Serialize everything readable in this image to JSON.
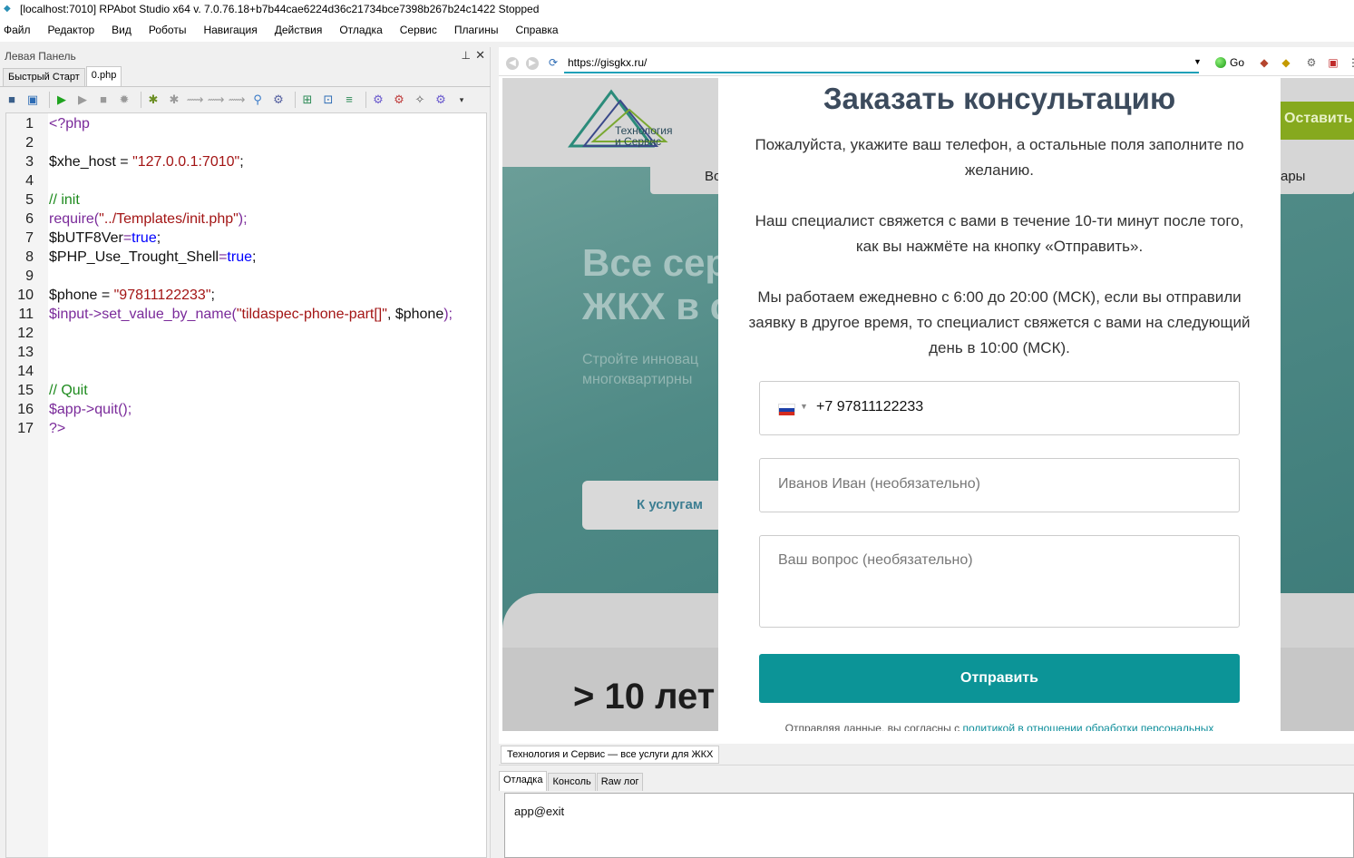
{
  "window": {
    "title": "[localhost:7010] RPAbot Studio x64 v. 7.0.76.18+b7b44cae6224d36c21734bce7398b267b24c1422 Stopped"
  },
  "menubar": {
    "items": [
      "Файл",
      "Редактор",
      "Вид",
      "Роботы",
      "Навигация",
      "Действия",
      "Отладка",
      "Сервис",
      "Плагины",
      "Справка"
    ]
  },
  "left_panel": {
    "title": "Левая Панель",
    "tabs": [
      "Быстрый Старт",
      "0.php"
    ],
    "active_tab": "0.php"
  },
  "editor": {
    "line_numbers": [
      "1",
      "2",
      "3",
      "4",
      "5",
      "6",
      "7",
      "8",
      "9",
      "10",
      "11",
      "12",
      "13",
      "14",
      "15",
      "16",
      "17"
    ]
  },
  "browser": {
    "url": "https://gisgkx.ru/",
    "go_label": "Go",
    "page_title_tab": "Технология и Сервис — все услуги для ЖКХ"
  },
  "site": {
    "logo_line1": "Технология",
    "logo_line2": "и Сервис",
    "cta": "Оставить",
    "menu_left": "Во",
    "menu_right": "ары",
    "hero_line1": "Все сер",
    "hero_line2": "ЖКХ в с",
    "hero_sub1": "Стройте инновац",
    "hero_sub2": "многоквартирны",
    "hero_button": "К услугам",
    "years": "> 10 лет"
  },
  "modal": {
    "title": "Заказать консультацию",
    "p1": "Пожалуйста, укажите ваш телефон, а остальные поля заполните по желанию.",
    "p2": "Наш специалист свяжется с вами в течение 10-ти минут после того, как вы нажмёте на кнопку «Отправить».",
    "p3": "Мы работаем ежедневно с 6:00 до 20:00 (МСК), если вы отправили заявку в другое время, то специалист свяжется с вами на следующий день в 10:00 (МСК).",
    "phone_value": "+7 97811122233",
    "name_placeholder": "Иванов Иван (необязательно)",
    "question_placeholder": "Ваш вопрос (необязательно)",
    "submit_label": "Отправить",
    "note_prefix": "Отправляя данные, вы согласны с ",
    "note_link": "политикой в отношении обработки персональных"
  },
  "debug": {
    "tabs": [
      "Отладка",
      "Консоль",
      "Raw лог"
    ],
    "active_tab": "Отладка",
    "output": "app@exit"
  }
}
